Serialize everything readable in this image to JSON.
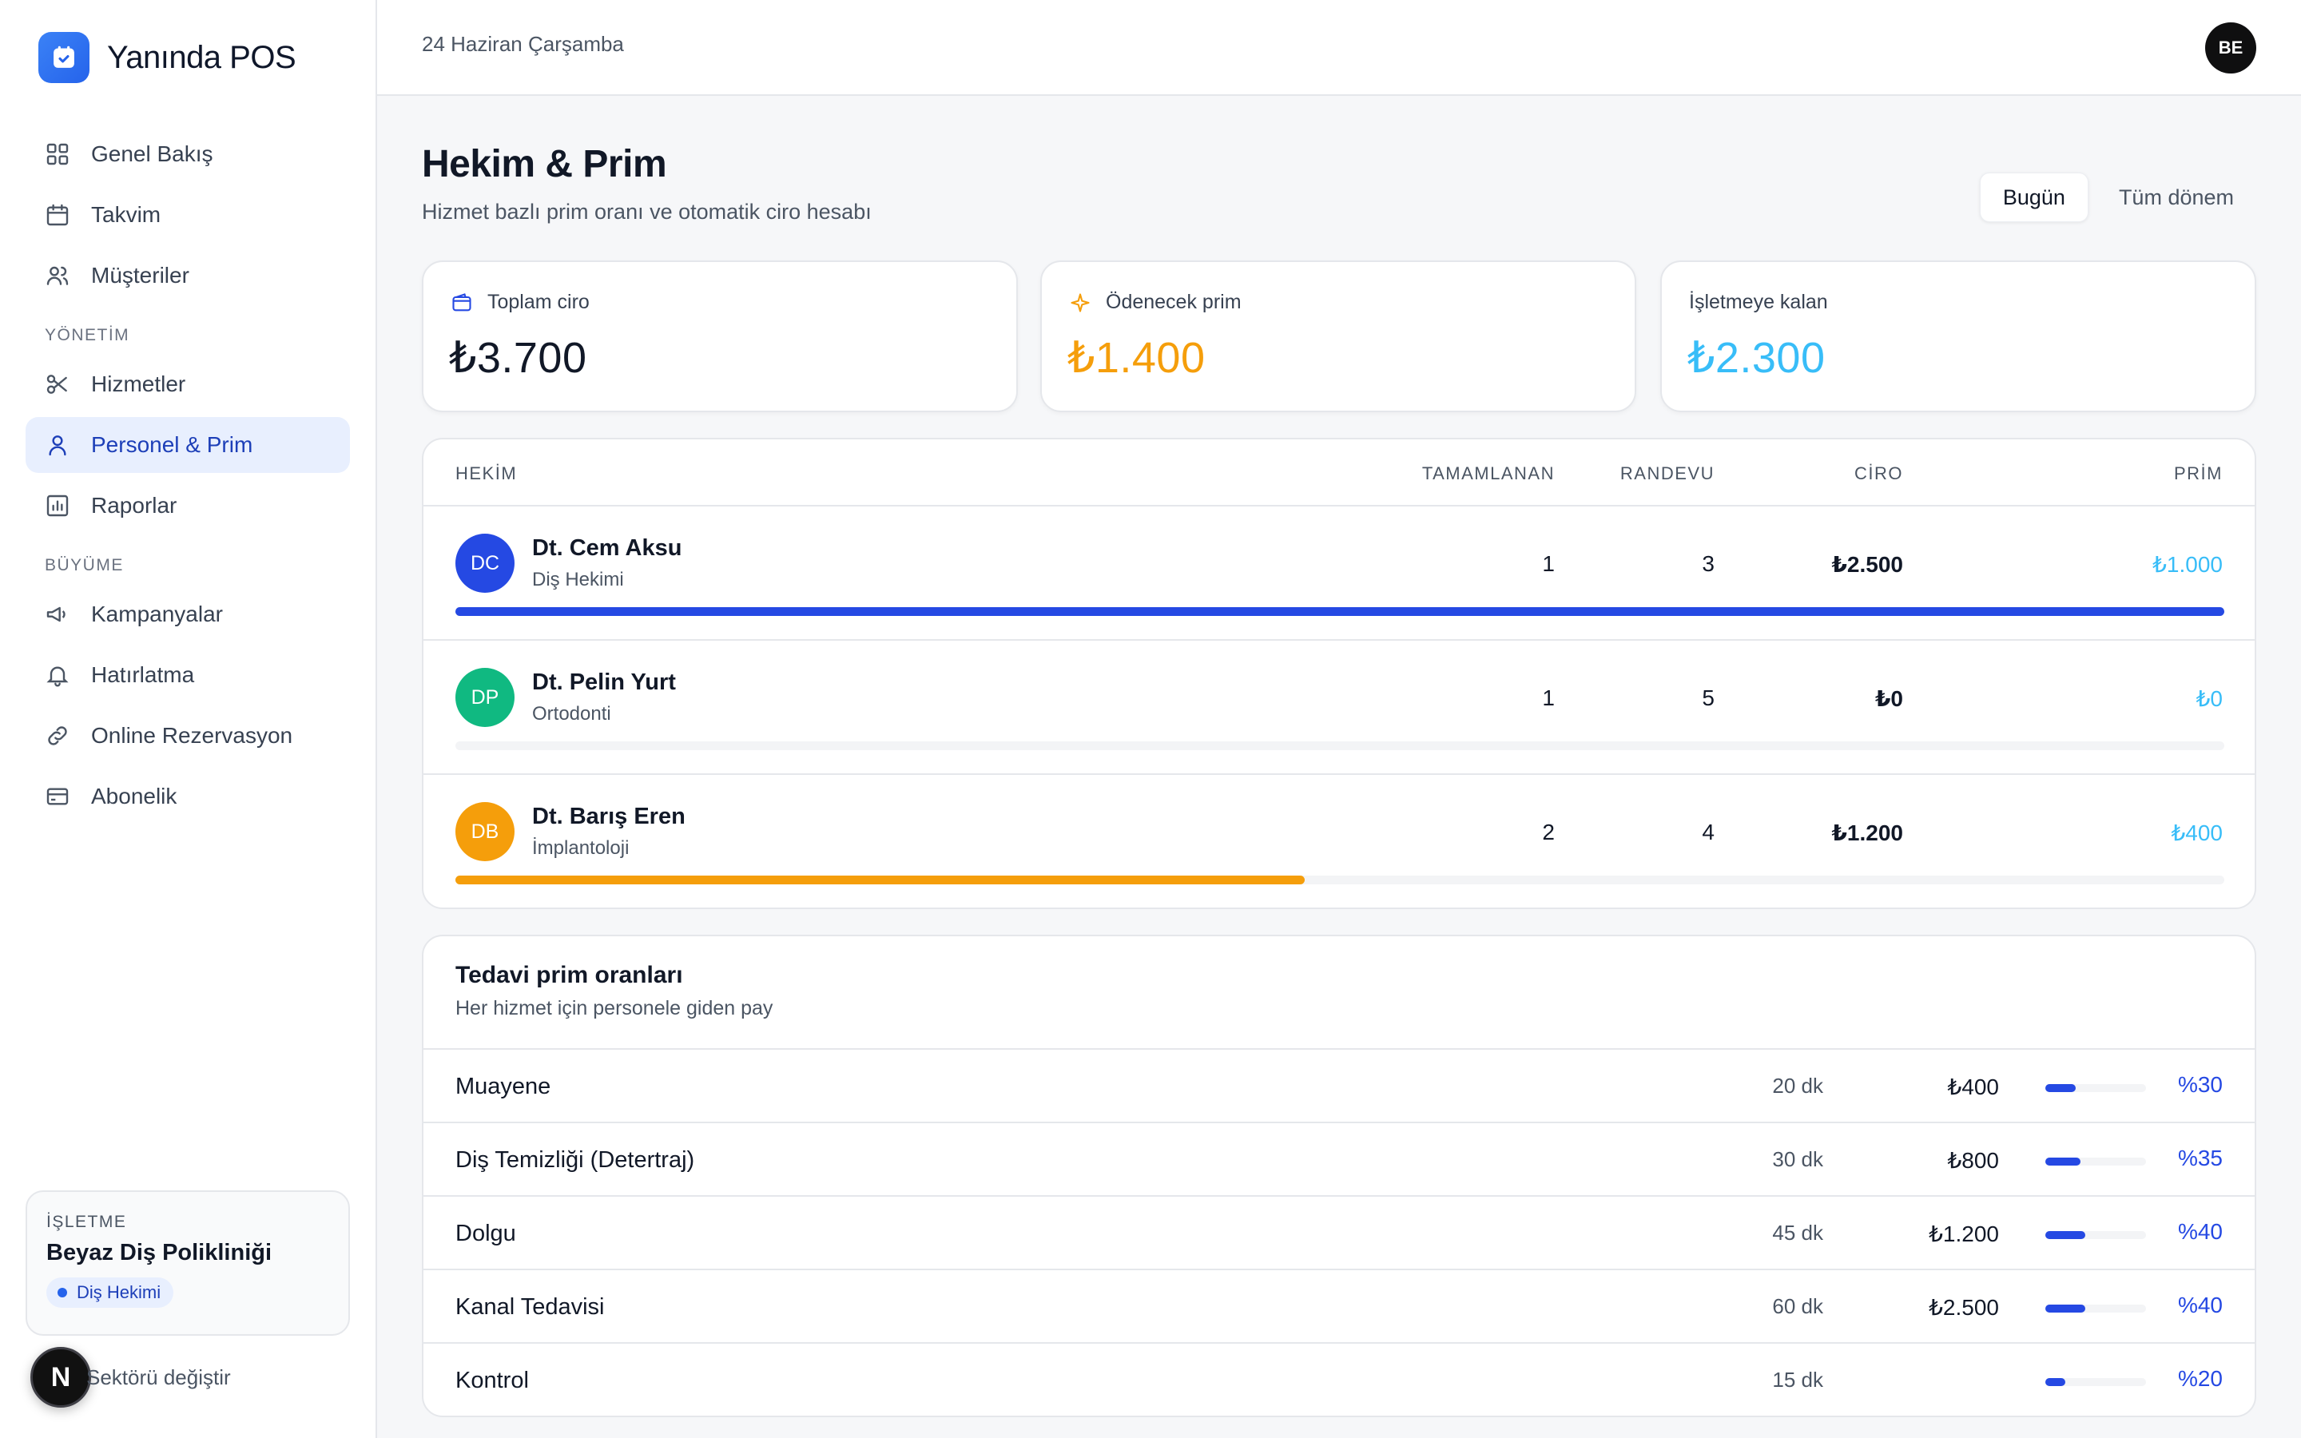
{
  "brand": {
    "name": "Yanında POS"
  },
  "colors": {
    "primary": "#2549e3",
    "amber": "#f59e0b",
    "sky": "#38bdf8",
    "green": "#10b981",
    "active_bg": "#e8effe"
  },
  "sidebar": {
    "main": [
      {
        "label": "Genel Bakış",
        "icon": "grid-icon"
      },
      {
        "label": "Takvim",
        "icon": "calendar-icon"
      },
      {
        "label": "Müşteriler",
        "icon": "users-icon"
      }
    ],
    "section_yonetim": "YÖNETİM",
    "yonetim": [
      {
        "label": "Hizmetler",
        "icon": "scissors-icon"
      },
      {
        "label": "Personel & Prim",
        "icon": "user-icon",
        "active": true
      },
      {
        "label": "Raporlar",
        "icon": "chart-icon"
      }
    ],
    "section_buyume": "BÜYÜME",
    "buyume": [
      {
        "label": "Kampanyalar",
        "icon": "megaphone-icon"
      },
      {
        "label": "Hatırlatma",
        "icon": "bell-icon"
      },
      {
        "label": "Online Rezervasyon",
        "icon": "link-icon"
      },
      {
        "label": "Abonelik",
        "icon": "card-icon"
      }
    ],
    "business": {
      "label": "İŞLETME",
      "name": "Beyaz Diş Polikliniği",
      "badge": "Diş Hekimi"
    },
    "sector_badge": "N",
    "sector_change": "Sektörü değiştir"
  },
  "topbar": {
    "date": "24 Haziran Çarşamba",
    "avatar": "BE"
  },
  "page": {
    "title": "Hekim & Prim",
    "subtitle": "Hizmet bazlı prim oranı ve otomatik ciro hesabı",
    "filters": [
      "Bugün",
      "Tüm dönem"
    ]
  },
  "stats": [
    {
      "label": "Toplam ciro",
      "value": "₺3.700",
      "icon": "wallet-icon"
    },
    {
      "label": "Ödenecek prim",
      "value": "₺1.400",
      "icon": "sparkle-icon"
    },
    {
      "label": "İşletmeye kalan",
      "value": "₺2.300",
      "icon": ""
    }
  ],
  "staff_table": {
    "headers": {
      "doctor": "HEKİM",
      "appointments": "RANDEVU",
      "completed": "TAMAMLANAN",
      "revenue": "CİRO",
      "bonus": "PRİM"
    },
    "rows": [
      {
        "initials": "DC",
        "name": "Dt. Cem Aksu",
        "specialty": "Diş Hekimi",
        "appointments": "3",
        "completed": "1",
        "revenue": "₺2.500",
        "bonus": "₺1.000",
        "share": 1.0,
        "color": "#2549e3"
      },
      {
        "initials": "DP",
        "name": "Dt. Pelin Yurt",
        "specialty": "Ortodonti",
        "appointments": "5",
        "completed": "1",
        "revenue": "₺0",
        "bonus": "₺0",
        "share": 0.0,
        "color": "#10b981"
      },
      {
        "initials": "DB",
        "name": "Dt. Barış Eren",
        "specialty": "İmplantoloji",
        "appointments": "4",
        "completed": "2",
        "revenue": "₺1.200",
        "bonus": "₺400",
        "share": 0.48,
        "color": "#f59e0b"
      }
    ]
  },
  "rates": {
    "title": "Tedavi prim oranları",
    "subtitle": "Her hizmet için personele giden pay",
    "rows": [
      {
        "name": "Muayene",
        "duration": "20 dk",
        "price": "₺400",
        "rate": "%30",
        "fill": 0.3
      },
      {
        "name": "Diş Temizliği (Detertraj)",
        "duration": "30 dk",
        "price": "₺800",
        "rate": "%35",
        "fill": 0.35
      },
      {
        "name": "Dolgu",
        "duration": "45 dk",
        "price": "₺1.200",
        "rate": "%40",
        "fill": 0.4
      },
      {
        "name": "Kanal Tedavisi",
        "duration": "60 dk",
        "price": "₺2.500",
        "rate": "%40",
        "fill": 0.4
      },
      {
        "name": "Kontrol",
        "duration": "15 dk",
        "price": "",
        "rate": "%20",
        "fill": 0.2
      }
    ]
  }
}
